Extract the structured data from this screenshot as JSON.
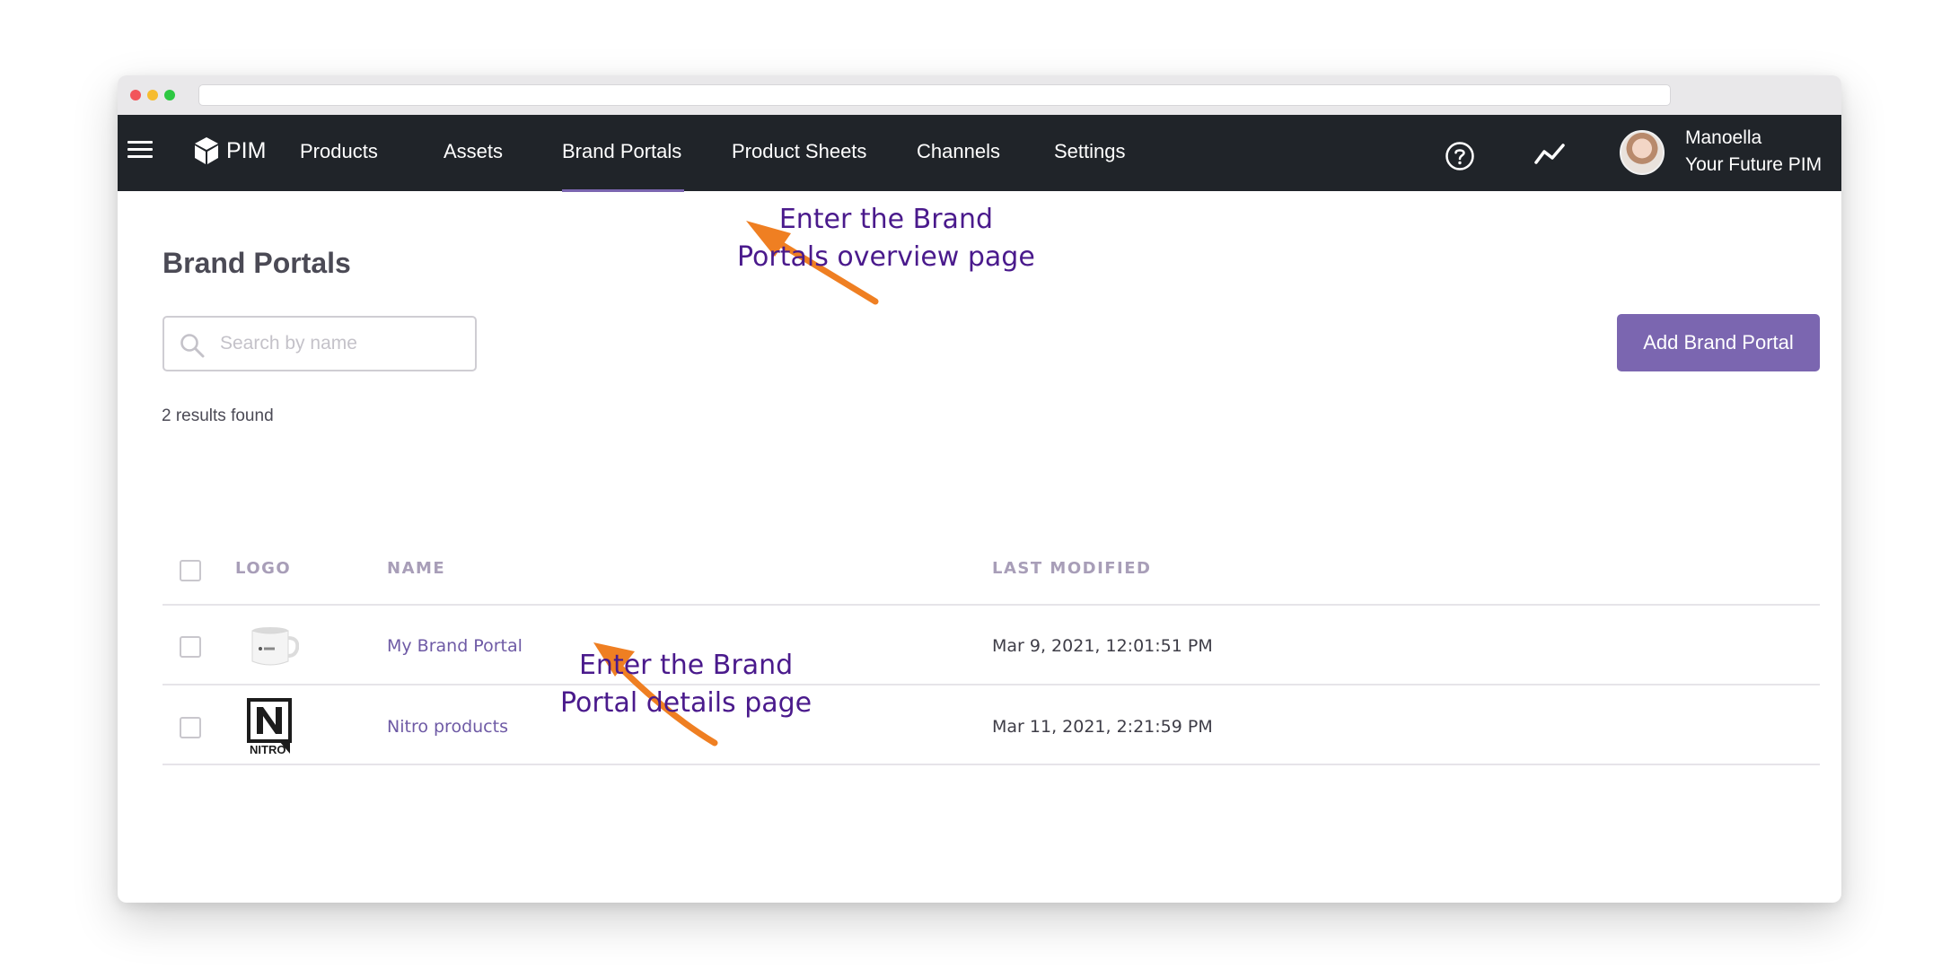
{
  "app": {
    "logo_text": "PIM"
  },
  "nav": {
    "items": [
      {
        "label": "Products"
      },
      {
        "label": "Assets"
      },
      {
        "label": "Brand Portals"
      },
      {
        "label": "Product Sheets"
      },
      {
        "label": "Channels"
      },
      {
        "label": "Settings"
      }
    ],
    "active": "Brand Portals"
  },
  "user": {
    "name": "Manoella",
    "company": "Your Future PIM"
  },
  "page": {
    "title": "Brand Portals",
    "search_placeholder": "Search by name",
    "add_button": "Add Brand Portal",
    "results_count": "2 results found"
  },
  "table": {
    "columns": [
      "LOGO",
      "NAME",
      "LAST MODIFIED"
    ],
    "rows": [
      {
        "name": "My Brand Portal",
        "last_modified": "Mar 9, 2021, 12:01:51 PM",
        "logo": "mug-logo"
      },
      {
        "name": "Nitro products",
        "last_modified": "Mar 11, 2021, 2:21:59 PM",
        "logo": "nitro-logo"
      }
    ]
  },
  "annotations": {
    "overview": [
      "Enter the Brand",
      "Portals overview page"
    ],
    "details": [
      "Enter the Brand",
      "Portal details page"
    ]
  },
  "colors": {
    "navbar": "#202429",
    "accent": "#7b66b0",
    "annotation_text": "#4a1a8c",
    "arrow": "#ef7f22"
  }
}
